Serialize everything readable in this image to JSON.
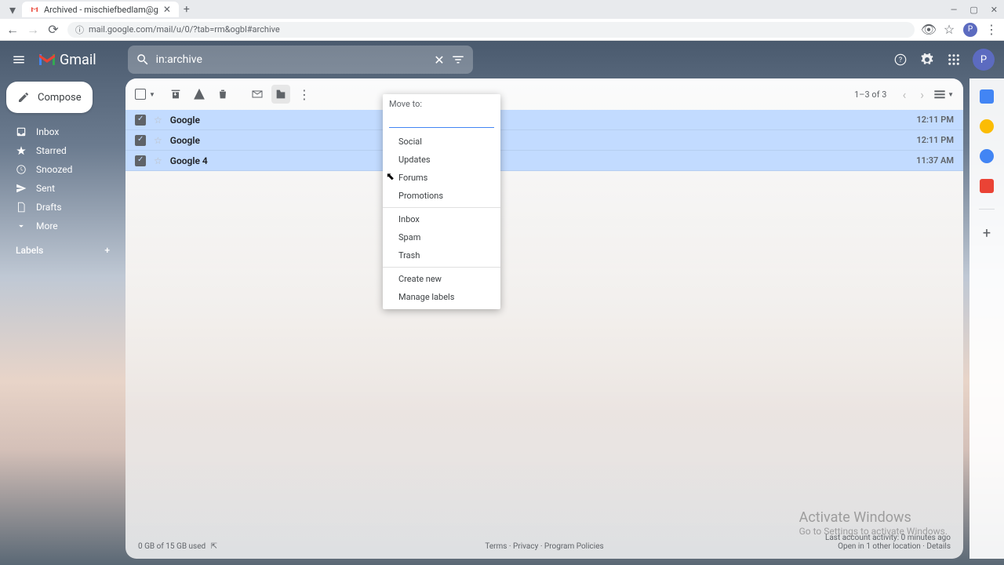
{
  "browser": {
    "tab_title": "Archived - mischiefbedlam@g",
    "url": "mail.google.com/mail/u/0/?tab=rm&ogbl#archive",
    "avatar_initial": "P"
  },
  "header": {
    "logo_text": "Gmail",
    "search_value": "in:archive",
    "avatar_initial": "P"
  },
  "sidebar": {
    "compose": "Compose",
    "items": [
      {
        "icon": "inbox",
        "label": "Inbox"
      },
      {
        "icon": "star",
        "label": "Starred"
      },
      {
        "icon": "clock",
        "label": "Snoozed"
      },
      {
        "icon": "send",
        "label": "Sent"
      },
      {
        "icon": "file",
        "label": "Drafts"
      },
      {
        "icon": "chevron-down",
        "label": "More"
      }
    ],
    "labels_header": "Labels"
  },
  "toolbar": {
    "pagination": "1–3 of 3"
  },
  "emails": [
    {
      "sender": "Google",
      "time": "12:11 PM"
    },
    {
      "sender": "Google",
      "time": "12:11 PM"
    },
    {
      "sender": "Google 4",
      "time": "11:37 AM"
    }
  ],
  "moveto": {
    "title": "Move to:",
    "groups": [
      [
        "Social",
        "Updates",
        "Forums",
        "Promotions"
      ],
      [
        "Inbox",
        "Spam",
        "Trash"
      ],
      [
        "Create new",
        "Manage labels"
      ]
    ]
  },
  "footer": {
    "storage": "0 GB of 15 GB used",
    "terms": "Terms",
    "privacy": "Privacy",
    "policies": "Program Policies",
    "activity": "Last account activity: 0 minutes ago",
    "open_in": "Open in 1 other location",
    "details": "Details"
  },
  "activate": {
    "title": "Activate Windows",
    "subtitle": "Go to Settings to activate Windows."
  }
}
